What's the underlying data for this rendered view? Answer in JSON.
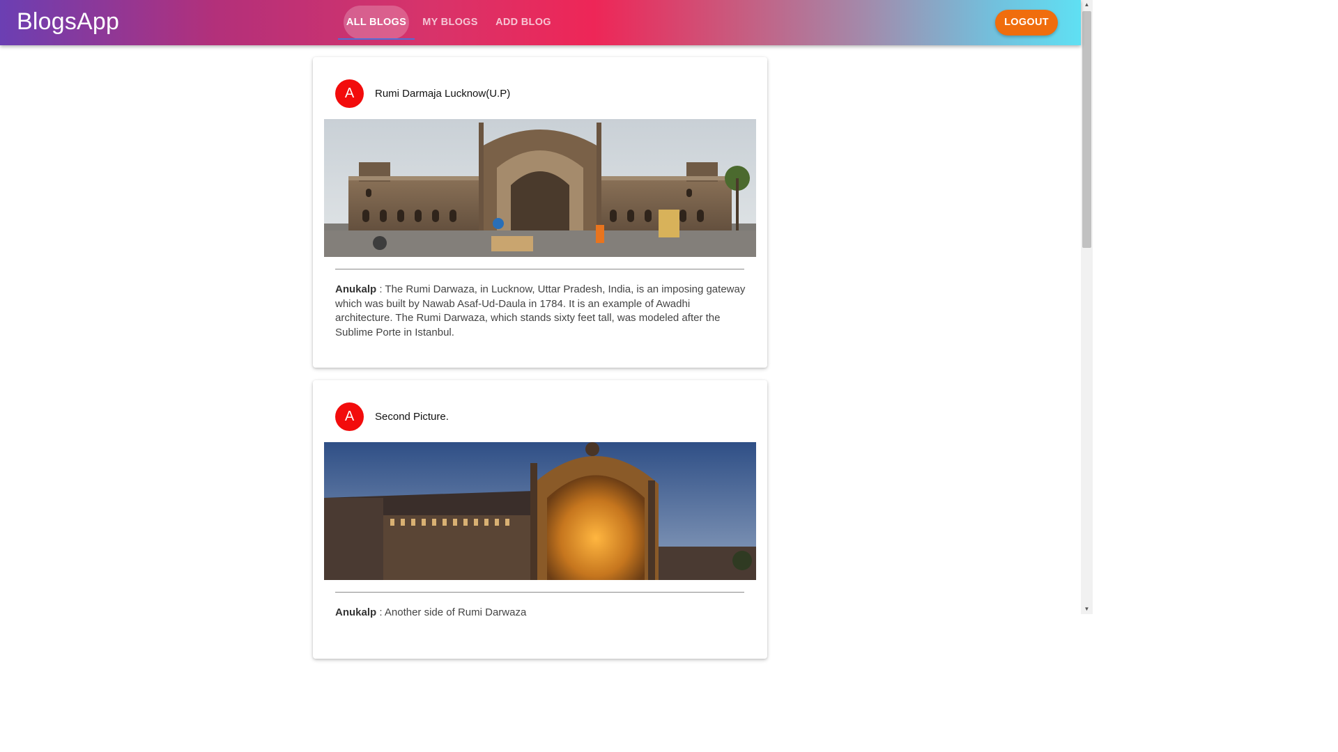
{
  "header": {
    "brand": "BlogsApp",
    "tabs": [
      {
        "label": "ALL BLOGS",
        "active": true
      },
      {
        "label": "MY BLOGS",
        "active": false
      },
      {
        "label": "ADD BLOG",
        "active": false
      }
    ],
    "logout_label": "LOGOUT"
  },
  "colors": {
    "avatar": "#f20c0c",
    "logout": "#f06d0d",
    "tab_indicator": "#4f6fd6"
  },
  "posts": [
    {
      "avatar_letter": "A",
      "title": "Rumi Darmaja Lucknow(U.P)",
      "image_icon": "rumi-darwaza-day-photo",
      "author": "Anukalp",
      "separator": " : ",
      "text": "The Rumi Darwaza, in Lucknow, Uttar Pradesh, India, is an imposing gateway which was built by Nawab Asaf-Ud-Daula in 1784. It is an example of Awadhi architecture. The Rumi Darwaza, which stands sixty feet tall, was modeled after the Sublime Porte in Istanbul."
    },
    {
      "avatar_letter": "A",
      "title": "Second Picture.",
      "image_icon": "rumi-darwaza-evening-photo",
      "author": "Anukalp",
      "separator": " : ",
      "text": "Another side of Rumi Darwaza"
    }
  ]
}
